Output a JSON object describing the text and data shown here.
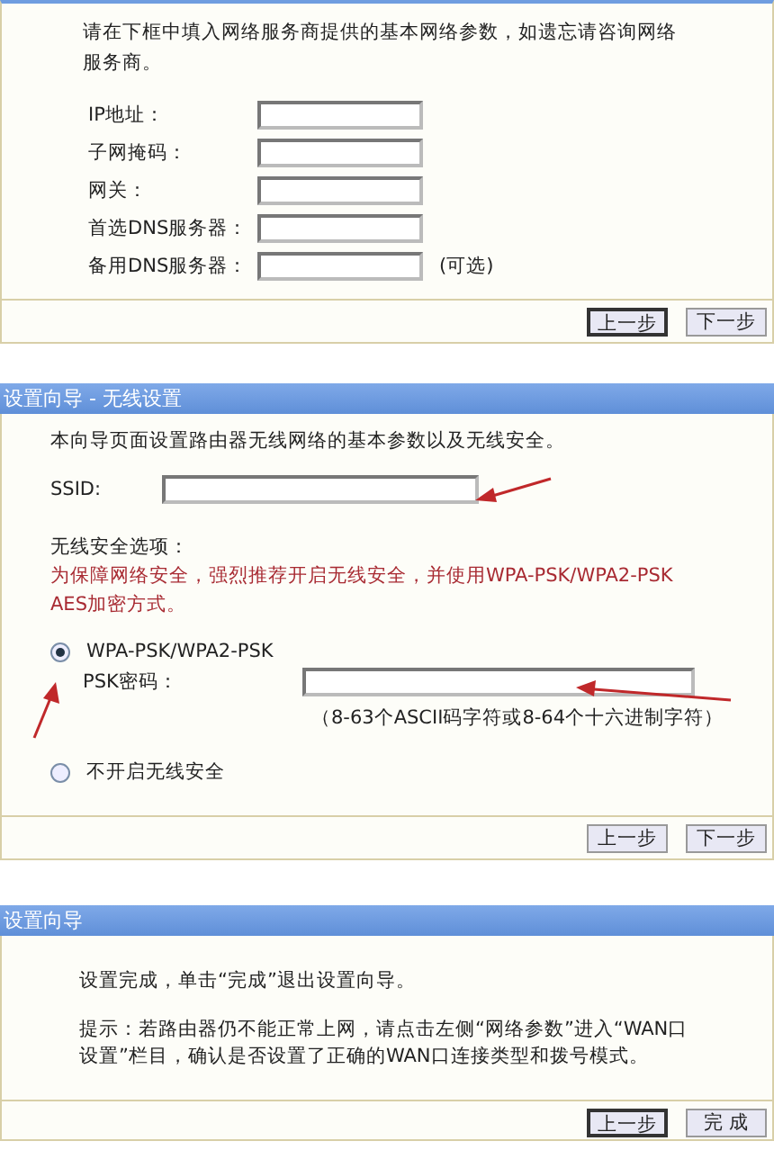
{
  "network_panel": {
    "intro": "请在下框中填入网络服务商提供的基本网络参数，如遗忘请咨询网络服务商。",
    "fields": [
      {
        "label": "IP地址："
      },
      {
        "label": "子网掩码："
      },
      {
        "label": "网关："
      },
      {
        "label": "首选DNS服务器："
      },
      {
        "label": "备用DNS服务器：",
        "note": "(可选)"
      }
    ],
    "buttons": [
      {
        "label": "上一步",
        "focused": true
      },
      {
        "label": "下一步",
        "focused": false
      }
    ]
  },
  "wireless_panel": {
    "title": "设置向导 - 无线设置",
    "intro": "本向导页面设置路由器无线网络的基本参数以及无线安全。",
    "ssid_label": "SSID:",
    "security_heading": "无线安全选项：",
    "warning": "为保障网络安全，强烈推荐开启无线安全，并使用WPA-PSK/WPA2-PSK AES加密方式。",
    "options": [
      {
        "label": "WPA-PSK/WPA2-PSK",
        "selected": true,
        "psk_label": "PSK密码：",
        "psk_hint": "（8-63个ASCII码字符或8-64个十六进制字符）"
      },
      {
        "label": "不开启无线安全",
        "selected": false
      }
    ],
    "buttons": [
      {
        "label": "上一步",
        "focused": false
      },
      {
        "label": "下一步",
        "focused": false
      }
    ]
  },
  "finish_panel": {
    "title": "设置向导",
    "message": "设置完成，单击“完成”退出设置向导。",
    "tip": "提示：若路由器仍不能正常上网，请点击左侧“网络参数”进入“WAN口设置”栏目，确认是否设置了正确的WAN口连接类型和拨号模式。",
    "buttons": [
      {
        "label": "上一步",
        "focused": true
      },
      {
        "label": "完 成",
        "focused": false
      }
    ]
  }
}
